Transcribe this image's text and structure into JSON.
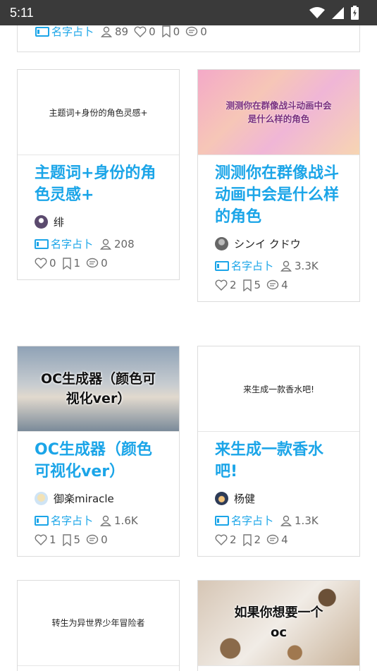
{
  "status": {
    "time": "5:11"
  },
  "top_card": {
    "tag": "名字占卜",
    "users": "89",
    "likes": "0",
    "bookmarks": "0",
    "comments": "0"
  },
  "cards": [
    {
      "thumb_text": "主题词+身份的角色灵感+",
      "title": "主题词+身份的角色灵感+",
      "author": "绯",
      "tag": "名字占卜",
      "users": "208",
      "likes": "0",
      "bookmarks": "1",
      "comments": "0"
    },
    {
      "thumb_text": "测测你在群像战斗动画中会是什么样的角色",
      "title": "测测你在群像战斗动画中会是什么样的角色",
      "author": "シンイ クドウ",
      "tag": "名字占卜",
      "users": "3.3K",
      "likes": "2",
      "bookmarks": "5",
      "comments": "4"
    },
    {
      "thumb_text": "OC生成器（颜色可视化ver）",
      "title": "OC生成器（颜色可视化ver）",
      "author": "御楽miracle",
      "tag": "名字占卜",
      "users": "1.6K",
      "likes": "1",
      "bookmarks": "5",
      "comments": "0"
    },
    {
      "thumb_text": "来生成一款香水吧!",
      "title": "来生成一款香水吧!",
      "author": "杨健",
      "tag": "名字占卜",
      "users": "1.3K",
      "likes": "2",
      "bookmarks": "2",
      "comments": "4"
    },
    {
      "thumb_text": "转生为异世界少年冒险者"
    },
    {
      "thumb_text": "如果你想要一个oc"
    }
  ]
}
